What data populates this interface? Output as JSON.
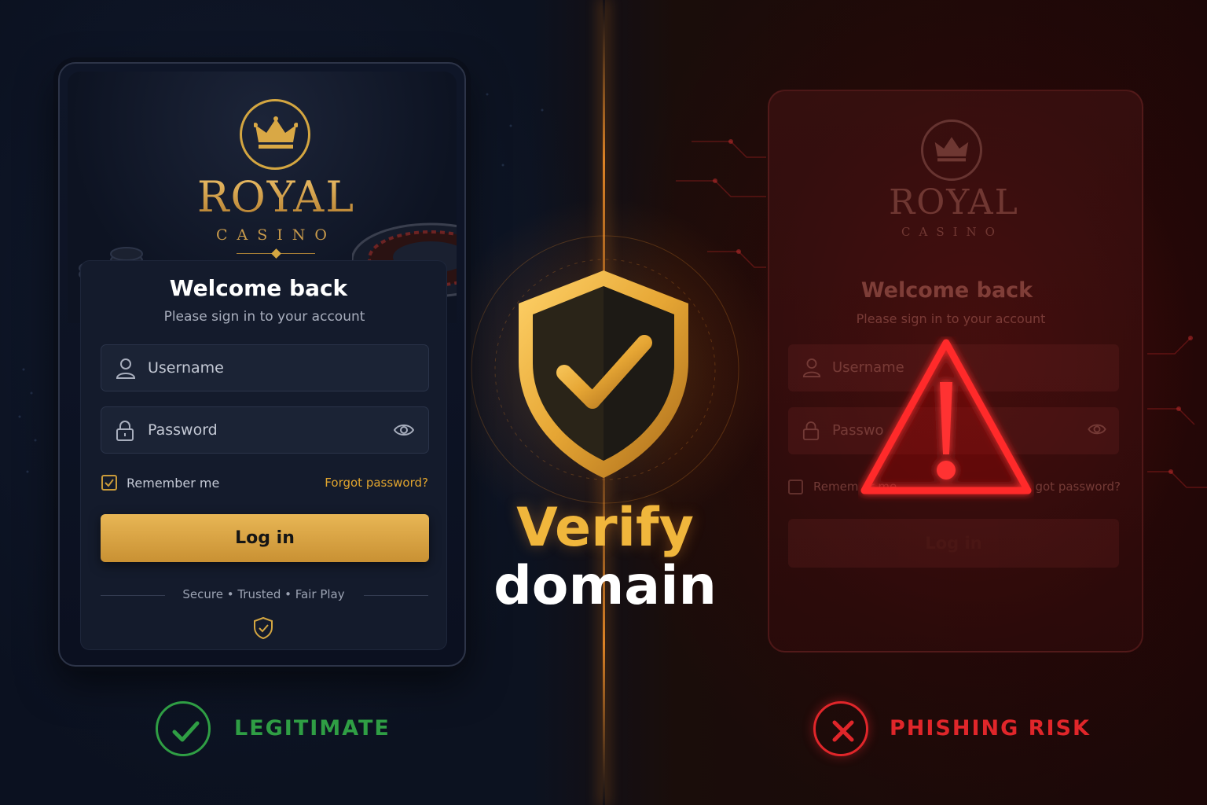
{
  "legitimate_card": {
    "brand_name": "ROYAL",
    "brand_sub": "CASINO",
    "welcome_title": "Welcome back",
    "welcome_subtitle": "Please sign in to your account",
    "username_placeholder": "Username",
    "password_placeholder": "Password",
    "remember_label": "Remember me",
    "remember_checked": true,
    "forgot_link": "Forgot password?",
    "login_button": "Log in",
    "trust_line": "Secure • Trusted • Fair Play",
    "accent_color": "#d4a641"
  },
  "center": {
    "verify_text": "Verify",
    "domain_text": "domain",
    "shield_icon": "shield-check-icon"
  },
  "phishing_card": {
    "brand_name": "ROYAL",
    "brand_sub": "CASINO",
    "welcome_title": "Welcome back",
    "welcome_subtitle": "Please sign in to your account",
    "username_placeholder": "Username",
    "password_placeholder": "Passwo",
    "remember_label": "Remem    er me",
    "forgot_link": "got password?",
    "login_button": "Log in",
    "warning_icon": "warning-triangle-icon",
    "accent_color": "#e0262a"
  },
  "verdicts": {
    "legit_label": "LEGITIMATE",
    "legit_color": "#2f9e44",
    "fake_label": "PHISHING RISK",
    "fake_color": "#e0262a"
  }
}
